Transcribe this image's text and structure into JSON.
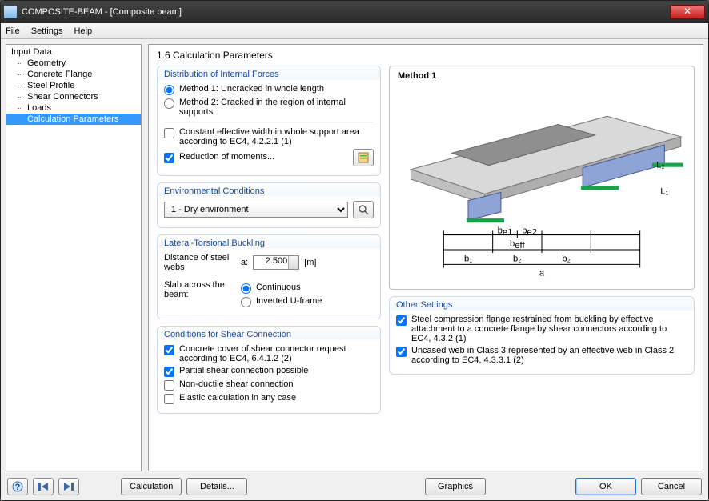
{
  "window": {
    "title": "COMPOSITE-BEAM - [Composite beam]"
  },
  "menu": {
    "file": "File",
    "settings": "Settings",
    "help": "Help"
  },
  "tree": {
    "root": "Input Data",
    "items": [
      "Geometry",
      "Concrete Flange",
      "Steel Profile",
      "Shear Connectors",
      "Loads",
      "Calculation Parameters"
    ],
    "selected_index": 5
  },
  "heading": "1.6 Calculation Parameters",
  "dist": {
    "legend": "Distribution of Internal Forces",
    "m1": "Method 1: Uncracked in whole length",
    "m2": "Method 2: Cracked in the region of internal supports",
    "const_width": "Constant effective width in whole support area according to EC4, 4.2.2.1 (1)",
    "reduction": "Reduction of moments..."
  },
  "env": {
    "legend": "Environmental Conditions",
    "selected": "1  - Dry environment"
  },
  "ltb": {
    "legend": "Lateral-Torsional Buckling",
    "dist_label": "Distance of steel webs",
    "a_label": "a:",
    "a_value": "2.500",
    "unit": "[m]",
    "slab_label": "Slab across the beam:",
    "cont": "Continuous",
    "uframe": "Inverted U-frame"
  },
  "shear": {
    "legend": "Conditions for Shear Connection",
    "cover": "Concrete cover of shear connector request according to EC4, 6.4.1.2 (2)",
    "partial": "Partial shear connection possible",
    "nonductile": "Non-ductile shear connection",
    "elastic": "Elastic calculation in any case"
  },
  "diagram": {
    "title": "Method 1"
  },
  "other": {
    "legend": "Other Settings",
    "flange": "Steel compression flange restrained from buckling by effective attachment to a concrete flange by shear connectors according to EC4, 4.3.2 (1)",
    "web": "Uncased web in Class 3 represented by an effective web in Class 2 according to EC4, 4.3.3.1 (2)"
  },
  "buttons": {
    "calculation": "Calculation",
    "details": "Details...",
    "graphics": "Graphics",
    "ok": "OK",
    "cancel": "Cancel"
  }
}
